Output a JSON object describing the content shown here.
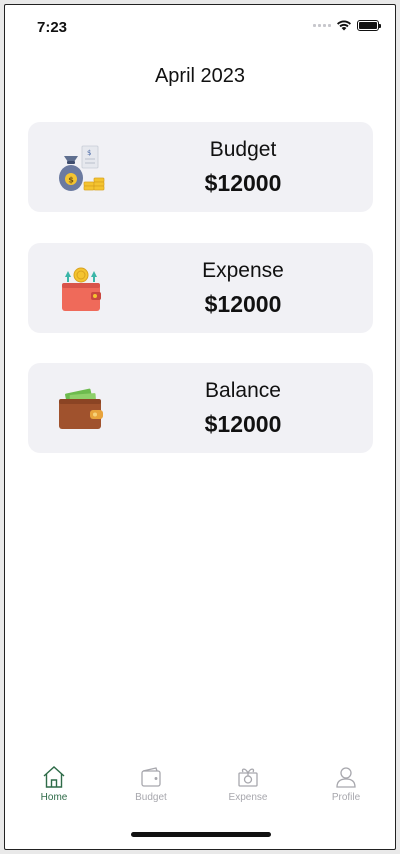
{
  "status_bar": {
    "time": "7:23"
  },
  "header": {
    "title": "April 2023"
  },
  "cards": [
    {
      "label": "Budget",
      "amount": "$12000",
      "icon": "money-bag-icon"
    },
    {
      "label": "Expense",
      "amount": "$12000",
      "icon": "wallet-coin-icon"
    },
    {
      "label": "Balance",
      "amount": "$12000",
      "icon": "wallet-icon"
    }
  ],
  "tab_bar": {
    "items": [
      {
        "label": "Home",
        "icon": "home-icon",
        "active": true
      },
      {
        "label": "Budget",
        "icon": "wallet-outline-icon",
        "active": false
      },
      {
        "label": "Expense",
        "icon": "gift-icon",
        "active": false
      },
      {
        "label": "Profile",
        "icon": "user-icon",
        "active": false
      }
    ],
    "active_color": "#2e6b48",
    "inactive_color": "#a7a7ad"
  }
}
